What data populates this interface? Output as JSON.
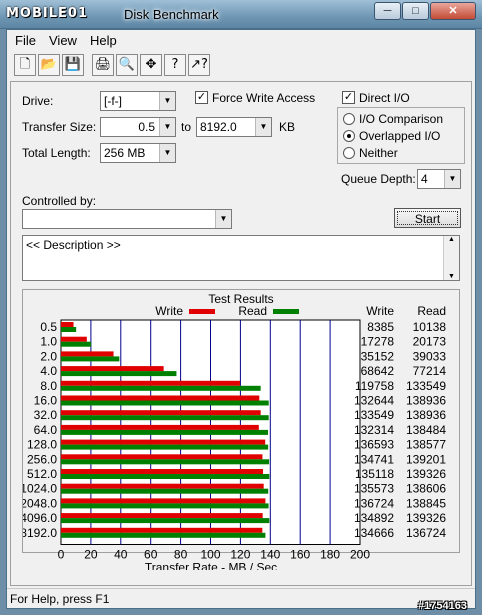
{
  "window": {
    "logo_text": "MOBILE01",
    "title": "Disk Benchmark",
    "minimize_glyph": "─",
    "maximize_glyph": "□",
    "close_glyph": "✕"
  },
  "menu": {
    "file": "File",
    "view": "View",
    "help": "Help"
  },
  "toolbar": {
    "icons": [
      "new-icon",
      "open-icon",
      "save-icon",
      "print-icon",
      "print-preview-icon",
      "move-icon",
      "help-icon",
      "context-help-icon"
    ],
    "glyphs": [
      "🗋",
      "📂",
      "💾",
      "🖨",
      "🔍",
      "✥",
      "?",
      "↗?"
    ]
  },
  "settings": {
    "drive_label": "Drive:",
    "drive_value": "[-f-]",
    "transfer_size_label": "Transfer Size:",
    "transfer_from": "0.5",
    "transfer_to_label": "to",
    "transfer_to": "8192.0",
    "transfer_unit": "KB",
    "total_length_label": "Total Length:",
    "total_length_value": "256 MB",
    "force_write_access": "Force Write Access",
    "force_write_checked": true,
    "direct_io": "Direct I/O",
    "direct_io_checked": true,
    "io_comparison": "I/O Comparison",
    "overlapped_io": "Overlapped I/O",
    "neither": "Neither",
    "selected_mode": "overlapped",
    "queue_depth_label": "Queue Depth:",
    "queue_depth_value": "4",
    "controlled_by_label": "Controlled by:",
    "controlled_by_value": "",
    "start_button": "Start",
    "description": "<< Description >>"
  },
  "status": {
    "text": "For Help, press F1"
  },
  "watermark": "#1754163",
  "chart_data": {
    "type": "bar",
    "orientation": "horizontal",
    "title": "Test Results",
    "xlabel": "Transfer Rate - MB / Sec",
    "xlim": [
      0,
      200
    ],
    "xticks": [
      0,
      20,
      40,
      60,
      80,
      100,
      120,
      140,
      160,
      180,
      200
    ],
    "legend_position": "top",
    "column_headers": [
      "Write",
      "Read"
    ],
    "categories": [
      "0.5",
      "1.0",
      "2.0",
      "4.0",
      "8.0",
      "16.0",
      "32.0",
      "64.0",
      "128.0",
      "256.0",
      "512.0",
      "1024.0",
      "2048.0",
      "4096.0",
      "8192.0"
    ],
    "series": [
      {
        "name": "Write",
        "color": "#e00000",
        "values_kb": [
          8385,
          17278,
          35152,
          68642,
          119758,
          132644,
          133549,
          132314,
          136593,
          134741,
          135118,
          135573,
          136724,
          134892,
          134666
        ]
      },
      {
        "name": "Read",
        "color": "#008000",
        "values_kb": [
          10138,
          20173,
          39033,
          77214,
          133549,
          138936,
          138936,
          138484,
          138577,
          139201,
          139326,
          138606,
          138845,
          139326,
          136724
        ]
      }
    ]
  }
}
